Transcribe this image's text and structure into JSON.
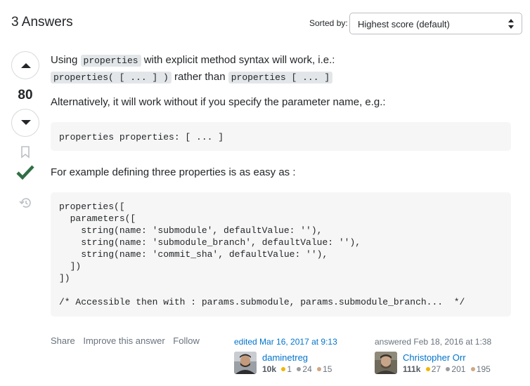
{
  "header": {
    "answers_count": "3 Answers",
    "sort_label": "Sorted by:",
    "sort_value": "Highest score (default)"
  },
  "vote": {
    "score": "80"
  },
  "post": {
    "p1_a": "Using ",
    "p1_code1": "properties",
    "p1_b": " with explicit method syntax will work, i.e.:",
    "p1_code2": "properties( [ ... ] )",
    "p1_c": " rather than ",
    "p1_code3": "properties [ ... ]",
    "p2": "Alternatively, it will work without if you specify the parameter name, e.g.:",
    "code1": "properties properties: [ ... ]",
    "p3": "For example defining three properties is as easy as :",
    "code2_lines": [
      "properties([",
      "  parameters([",
      "    string(name: 'submodule', defaultValue: ''),",
      "    string(name: 'submodule_branch', defaultValue: ''),",
      "    string(name: 'commit_sha', defaultValue: ''),",
      "  ])",
      "])",
      "",
      "/* Accessible then with : params.submodule, params.submodule_branch...  */"
    ]
  },
  "actions": {
    "share": "Share",
    "improve": "Improve this answer",
    "follow": "Follow"
  },
  "editor": {
    "when": "edited Mar 16, 2017 at 9:13",
    "name": "daminetreg",
    "rep": "10k",
    "gold": "1",
    "silver": "24",
    "bronze": "15"
  },
  "author": {
    "when": "answered Feb 18, 2016 at 1:38",
    "name": "Christopher Orr",
    "rep": "111k",
    "gold": "27",
    "silver": "201",
    "bronze": "195"
  },
  "colors": {
    "accepted": "#2f6f44",
    "link": "#0074cc",
    "code_bg": "#f6f6f6"
  },
  "icons": [
    "upvote-icon",
    "downvote-icon",
    "bookmark-icon",
    "checkmark-icon",
    "history-icon",
    "select-caret-icon"
  ]
}
